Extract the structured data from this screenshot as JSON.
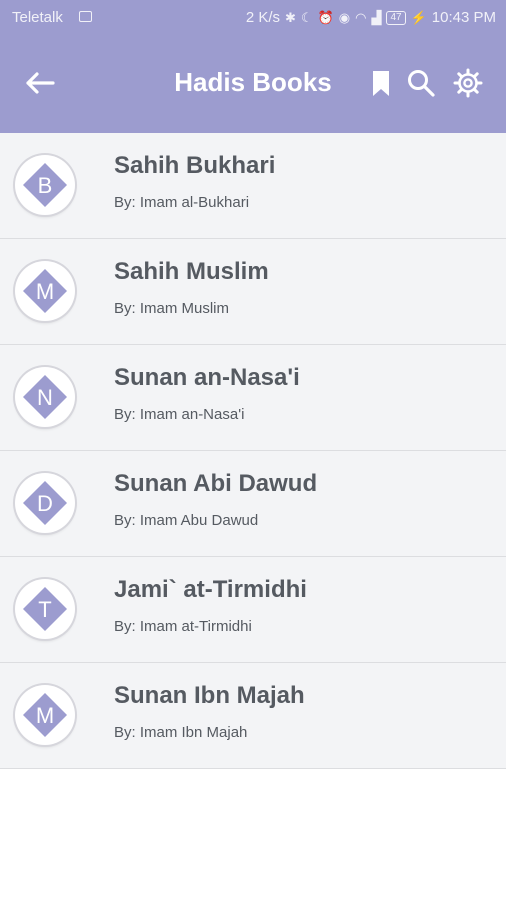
{
  "status": {
    "carrier": "Teletalk",
    "speed": "2 K/s",
    "battery": "47",
    "time": "10:43 PM"
  },
  "toolbar": {
    "title": "Hadis Books"
  },
  "books": [
    {
      "letter": "B",
      "title": "Sahih Bukhari",
      "author": "By: Imam al-Bukhari"
    },
    {
      "letter": "M",
      "title": "Sahih Muslim",
      "author": "By: Imam Muslim"
    },
    {
      "letter": "N",
      "title": "Sunan an-Nasa'i",
      "author": "By: Imam an-Nasa'i"
    },
    {
      "letter": "D",
      "title": "Sunan Abi Dawud",
      "author": "By: Imam Abu Dawud"
    },
    {
      "letter": "T",
      "title": "Jami` at-Tirmidhi",
      "author": "By: Imam at-Tirmidhi"
    },
    {
      "letter": "M",
      "title": "Sunan Ibn Majah",
      "author": "By: Imam Ibn Majah"
    }
  ],
  "colors": {
    "appbar": "#9c9ccf",
    "diamond": "#9c9ccf",
    "row_background": "#f3f4f6",
    "text": "#555a61"
  }
}
